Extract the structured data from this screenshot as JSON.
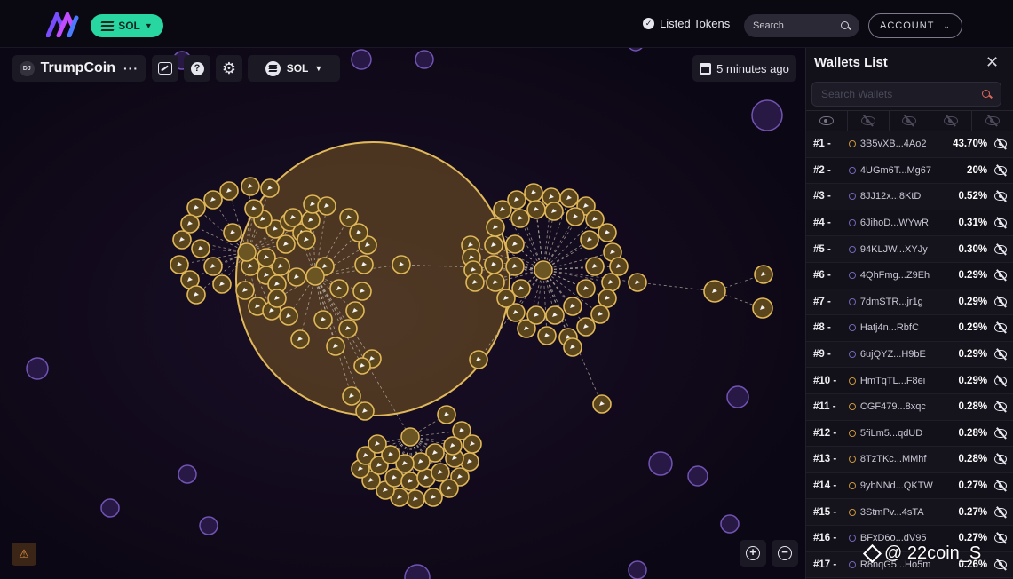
{
  "header": {
    "chain_label": "SOL",
    "listed_tokens_label": "Listed Tokens",
    "search_placeholder": "Search",
    "account_label": "ACCOUNT"
  },
  "toolbar": {
    "token_avatar": "DJ",
    "token_name": "TrumpCoin",
    "more_label": "···",
    "chain_select": "SOL",
    "time_label": "5 minutes ago"
  },
  "panel": {
    "title": "Wallets List",
    "search_placeholder": "Search Wallets",
    "wallets": [
      {
        "rank": "#1 -",
        "address": "3B5vXB...4Ao2",
        "percent": "43.70%",
        "dot_color": "#c9943a"
      },
      {
        "rank": "#2 -",
        "address": "4UGm6T...Mg67",
        "percent": "20%",
        "dot_color": "#6f66b5"
      },
      {
        "rank": "#3 -",
        "address": "8JJ12x...8KtD",
        "percent": "0.52%",
        "dot_color": "#6f66b5"
      },
      {
        "rank": "#4 -",
        "address": "6JihoD...WYwR",
        "percent": "0.31%",
        "dot_color": "#6f66b5"
      },
      {
        "rank": "#5 -",
        "address": "94KLJW...XYJy",
        "percent": "0.30%",
        "dot_color": "#6f66b5"
      },
      {
        "rank": "#6 -",
        "address": "4QhFmg...Z9Eh",
        "percent": "0.29%",
        "dot_color": "#6f66b5"
      },
      {
        "rank": "#7 -",
        "address": "7dmSTR...jr1g",
        "percent": "0.29%",
        "dot_color": "#6f66b5"
      },
      {
        "rank": "#8 -",
        "address": "Hatj4n...RbfC",
        "percent": "0.29%",
        "dot_color": "#6f66b5"
      },
      {
        "rank": "#9 -",
        "address": "6ujQYZ...H9bE",
        "percent": "0.29%",
        "dot_color": "#6f66b5"
      },
      {
        "rank": "#10 -",
        "address": "HmTqTL...F8ei",
        "percent": "0.29%",
        "dot_color": "#c9943a"
      },
      {
        "rank": "#11 -",
        "address": "CGF479...8xqc",
        "percent": "0.28%",
        "dot_color": "#c9943a"
      },
      {
        "rank": "#12 -",
        "address": "5fiLm5...qdUD",
        "percent": "0.28%",
        "dot_color": "#c9943a"
      },
      {
        "rank": "#13 -",
        "address": "8TzTKc...MMhf",
        "percent": "0.28%",
        "dot_color": "#c9943a"
      },
      {
        "rank": "#14 -",
        "address": "9ybNNd...QKTW",
        "percent": "0.27%",
        "dot_color": "#c9943a"
      },
      {
        "rank": "#15 -",
        "address": "3StmPv...4sTA",
        "percent": "0.27%",
        "dot_color": "#c9943a"
      },
      {
        "rank": "#16 -",
        "address": "BFxD6o...dV95",
        "percent": "0.27%",
        "dot_color": "#6f66b5"
      },
      {
        "rank": "#17 -",
        "address": "R8nqG5...Ho5m",
        "percent": "0.26%",
        "dot_color": "#6f66b5"
      }
    ]
  },
  "watermark": "@ 22coin_S",
  "colors": {
    "accent": "#27d6a0",
    "bubble_stroke": "#e0b85a",
    "bubble_fill": "#7a5a22",
    "outlier_bubble": "#7c5cc4"
  }
}
